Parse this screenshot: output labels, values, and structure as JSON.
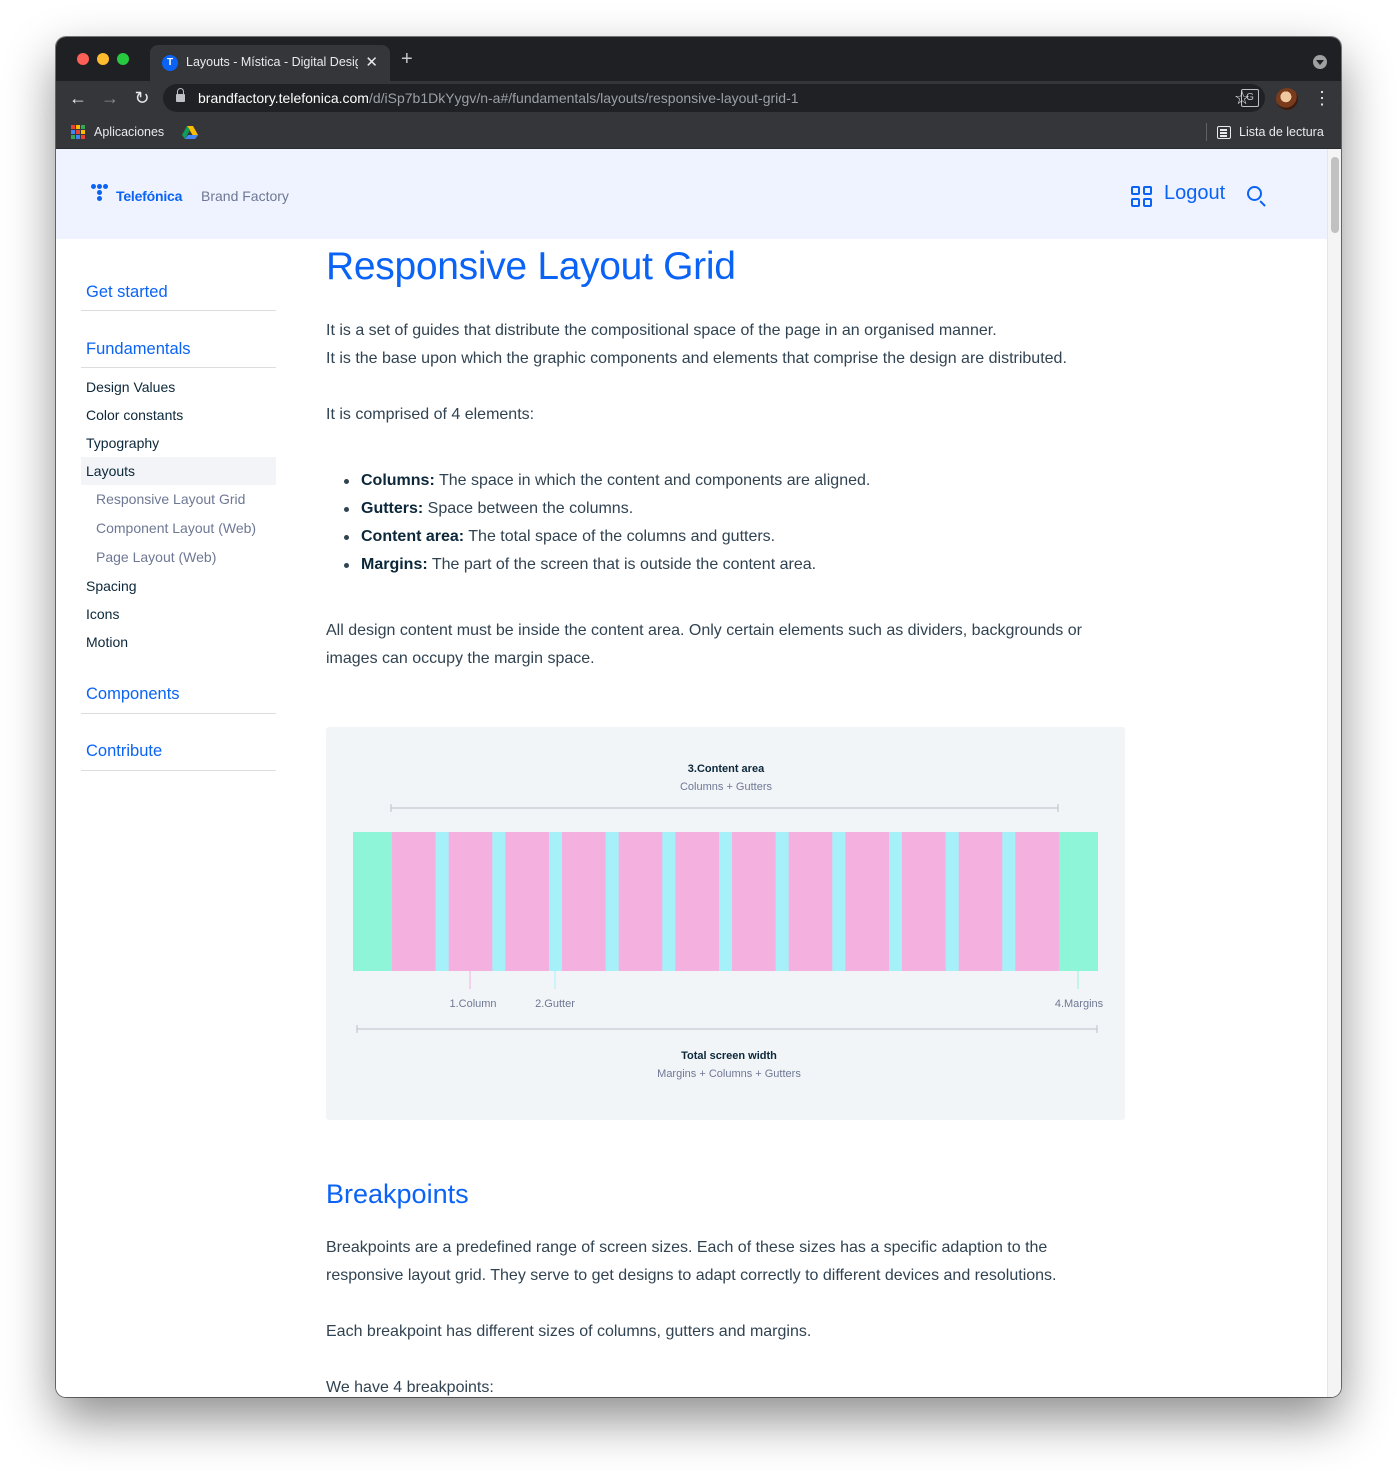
{
  "browser": {
    "tab_title": "Layouts - Mística - Digital Design System",
    "url_host": "brandfactory.telefonica.com",
    "url_path": "/d/iSp7b1DkYygv/n-a#/fundamentals/layouts/responsive-layout-grid-1",
    "bookmarks": {
      "apps_label": "Aplicaciones",
      "reading_list_label": "Lista de lectura"
    }
  },
  "header": {
    "logo_text": "Telefónica",
    "site_name": "Brand Factory",
    "logout_label": "Logout"
  },
  "sidebar": {
    "sections": [
      {
        "label": "Get started"
      },
      {
        "label": "Fundamentals"
      },
      {
        "label": "Components"
      },
      {
        "label": "Contribute"
      }
    ],
    "fundamentals_items": [
      {
        "label": "Design Values"
      },
      {
        "label": "Color constants"
      },
      {
        "label": "Typography"
      },
      {
        "label": "Layouts"
      },
      {
        "label": "Spacing"
      },
      {
        "label": "Icons"
      },
      {
        "label": "Motion"
      }
    ],
    "layouts_subitems": [
      {
        "label": "Responsive Layout Grid"
      },
      {
        "label": "Component Layout (Web)"
      },
      {
        "label": "Page Layout (Web)"
      }
    ]
  },
  "main": {
    "title": "Responsive Layout Grid",
    "intro_1": "It is a set of guides that distribute the compositional space of the page in an organised manner.",
    "intro_2": "It is the base upon which the graphic components and elements that comprise the design are distributed.",
    "elements_intro": "It is comprised of 4 elements:",
    "bullets": [
      {
        "term": "Columns:",
        "text": " The space in which the content and components are aligned."
      },
      {
        "term": "Gutters:",
        "text": " Space between the columns."
      },
      {
        "term": "Content area:",
        "text": " The total space of the columns and gutters."
      },
      {
        "term": "Margins:",
        "text": " The part of the screen that is outside the content area."
      }
    ],
    "content_note": "All design content must be inside the content area. Only certain elements such as dividers, backgrounds or images can occupy the margin space.",
    "diagram": {
      "content_area_title": "3.Content area",
      "content_area_sub": "Columns + Gutters",
      "column_label": "1.Column",
      "gutter_label": "2.Gutter",
      "margins_label": "4.Margins",
      "total_title": "Total screen width",
      "total_sub": "Margins + Columns + Gutters",
      "columns": 12,
      "colors": {
        "margin": "#8ef5d9",
        "column": "#f4b1df",
        "gutter": "#a6f1f9",
        "background": "#f2f5f8"
      }
    },
    "breakpoints_title": "Breakpoints",
    "breakpoints_p1": "Breakpoints are a predefined range of screen sizes. Each of these sizes has a specific adaption to the responsive layout grid. They serve to get designs to adapt correctly to different devices and resolutions.",
    "breakpoints_p2": "Each breakpoint has different sizes of columns, gutters and margins.",
    "breakpoints_p3": "We have 4 breakpoints:"
  },
  "colors": {
    "brand_blue": "#0b63f6",
    "header_bg": "#eef3ff",
    "text": "#314351"
  }
}
